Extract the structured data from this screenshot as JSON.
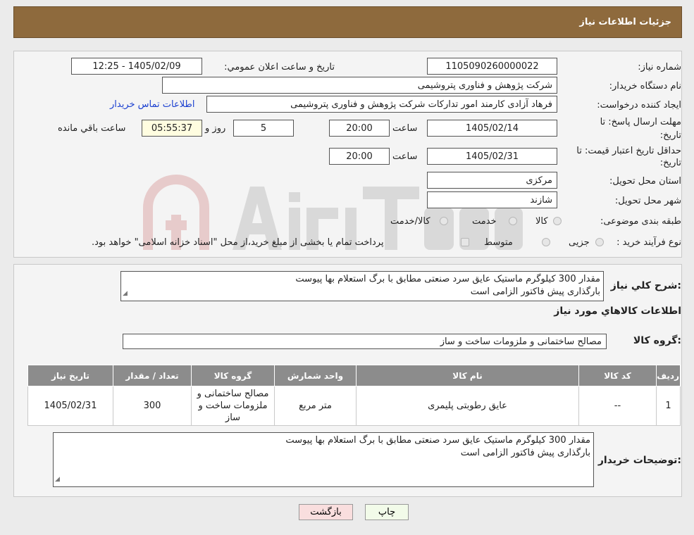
{
  "header": {
    "title": "جزئیات اطلاعات نیاز"
  },
  "fields": {
    "need_number_label": "شماره نیاز:",
    "need_number": "1105090260000022",
    "announce_label": "تاریخ و ساعت اعلان عمومي:",
    "announce_value": "1405/02/09 - 12:25",
    "buyer_org_label": "نام دستگاه خریدار:",
    "buyer_org": "شرکت پژوهش و فناوری پتروشیمی",
    "creator_label": "ایجاد کننده درخواست:",
    "creator": "فرهاد آزادی کارمند امور تدارکات شرکت پژوهش و فناوری پتروشیمی",
    "contact_link": "اطلاعات تماس خریدار",
    "deadline_label_1": "مهلت ارسال پاسخ: تا",
    "deadline_label_2": "تاریخ:",
    "deadline_date": "1405/02/14",
    "time_label": "ساعت",
    "deadline_time": "20:00",
    "days_value": "5",
    "days_label": "روز و",
    "remaining_time": "05:55:37",
    "remaining_label": "ساعت باقي مانده",
    "validity_label_1": "حداقل تاریخ اعتبار قیمت: تا",
    "validity_label_2": "تاریخ:",
    "validity_date": "1405/02/31",
    "validity_time": "20:00",
    "province_label": "استان محل تحویل:",
    "province": "مرکزی",
    "city_label": "شهر محل تحویل:",
    "city": "شازند",
    "category_label": "طبقه بندی موضوعی:",
    "category_options": [
      "کالا",
      "خدمت",
      "کالا/خدمت"
    ],
    "process_label": "نوع فرآیند خرید :",
    "process_options": [
      "جزیی",
      "متوسط"
    ],
    "process_note": "پرداخت تمام یا بخشی از مبلغ خرید،از محل \"اسناد خزانه اسلامی\" خواهد بود."
  },
  "description": {
    "label": "شرح کلي نیاز:",
    "line1": "مقدار 300 کیلوگرم ماستیک عایق سرد صنعتی مطابق با برگ استعلام بها پیوست",
    "line2": "بارگذاری پیش فاکتور الزامی است"
  },
  "goods": {
    "section_title": "اطلاعات کالاهاي مورد نیاز",
    "group_label": "گروه کالا:",
    "group_value": "مصالح ساختمانی و ملزومات ساخت و ساز",
    "table": {
      "headers": [
        "ردیف",
        "کد کالا",
        "نام کالا",
        "واحد شمارش",
        "گروه کالا",
        "تعداد / مقدار",
        "تاریخ نیاز"
      ],
      "rows": [
        [
          "1",
          "--",
          "عایق رطوبتی پلیمری",
          "متر مربع",
          "مصالح ساختمانی و ملزومات ساخت و ساز",
          "300",
          "1405/02/31"
        ]
      ]
    }
  },
  "buyer_notes": {
    "label": "توضیحات خریدار:",
    "line1": "مقدار 300 کیلوگرم ماستیک عایق سرد صنعتی مطابق با برگ استعلام بها پیوست",
    "line2": "بارگذاری پیش فاکتور الزامی است"
  },
  "buttons": {
    "print": "چاپ",
    "back": "بازگشت"
  },
  "colors": {
    "header": "#8e6a3d",
    "table_header": "#8c8c8c",
    "link": "#1a3fd0",
    "back_button": "#f9dede"
  }
}
